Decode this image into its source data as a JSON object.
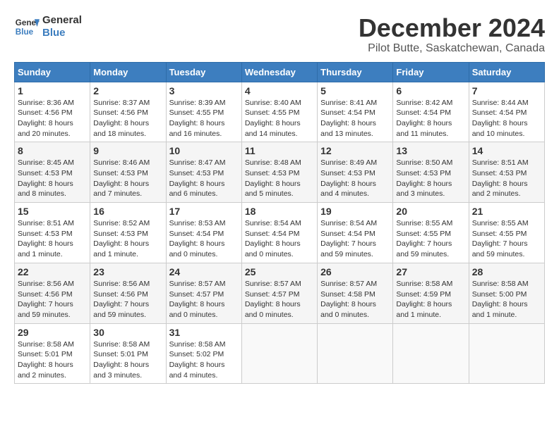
{
  "header": {
    "logo_line1": "General",
    "logo_line2": "Blue",
    "month": "December 2024",
    "location": "Pilot Butte, Saskatchewan, Canada"
  },
  "days_of_week": [
    "Sunday",
    "Monday",
    "Tuesday",
    "Wednesday",
    "Thursday",
    "Friday",
    "Saturday"
  ],
  "weeks": [
    [
      {
        "day": "1",
        "info": "Sunrise: 8:36 AM\nSunset: 4:56 PM\nDaylight: 8 hours and 20 minutes."
      },
      {
        "day": "2",
        "info": "Sunrise: 8:37 AM\nSunset: 4:56 PM\nDaylight: 8 hours and 18 minutes."
      },
      {
        "day": "3",
        "info": "Sunrise: 8:39 AM\nSunset: 4:55 PM\nDaylight: 8 hours and 16 minutes."
      },
      {
        "day": "4",
        "info": "Sunrise: 8:40 AM\nSunset: 4:55 PM\nDaylight: 8 hours and 14 minutes."
      },
      {
        "day": "5",
        "info": "Sunrise: 8:41 AM\nSunset: 4:54 PM\nDaylight: 8 hours and 13 minutes."
      },
      {
        "day": "6",
        "info": "Sunrise: 8:42 AM\nSunset: 4:54 PM\nDaylight: 8 hours and 11 minutes."
      },
      {
        "day": "7",
        "info": "Sunrise: 8:44 AM\nSunset: 4:54 PM\nDaylight: 8 hours and 10 minutes."
      }
    ],
    [
      {
        "day": "8",
        "info": "Sunrise: 8:45 AM\nSunset: 4:53 PM\nDaylight: 8 hours and 8 minutes."
      },
      {
        "day": "9",
        "info": "Sunrise: 8:46 AM\nSunset: 4:53 PM\nDaylight: 8 hours and 7 minutes."
      },
      {
        "day": "10",
        "info": "Sunrise: 8:47 AM\nSunset: 4:53 PM\nDaylight: 8 hours and 6 minutes."
      },
      {
        "day": "11",
        "info": "Sunrise: 8:48 AM\nSunset: 4:53 PM\nDaylight: 8 hours and 5 minutes."
      },
      {
        "day": "12",
        "info": "Sunrise: 8:49 AM\nSunset: 4:53 PM\nDaylight: 8 hours and 4 minutes."
      },
      {
        "day": "13",
        "info": "Sunrise: 8:50 AM\nSunset: 4:53 PM\nDaylight: 8 hours and 3 minutes."
      },
      {
        "day": "14",
        "info": "Sunrise: 8:51 AM\nSunset: 4:53 PM\nDaylight: 8 hours and 2 minutes."
      }
    ],
    [
      {
        "day": "15",
        "info": "Sunrise: 8:51 AM\nSunset: 4:53 PM\nDaylight: 8 hours and 1 minute."
      },
      {
        "day": "16",
        "info": "Sunrise: 8:52 AM\nSunset: 4:53 PM\nDaylight: 8 hours and 1 minute."
      },
      {
        "day": "17",
        "info": "Sunrise: 8:53 AM\nSunset: 4:54 PM\nDaylight: 8 hours and 0 minutes."
      },
      {
        "day": "18",
        "info": "Sunrise: 8:54 AM\nSunset: 4:54 PM\nDaylight: 8 hours and 0 minutes."
      },
      {
        "day": "19",
        "info": "Sunrise: 8:54 AM\nSunset: 4:54 PM\nDaylight: 7 hours and 59 minutes."
      },
      {
        "day": "20",
        "info": "Sunrise: 8:55 AM\nSunset: 4:55 PM\nDaylight: 7 hours and 59 minutes."
      },
      {
        "day": "21",
        "info": "Sunrise: 8:55 AM\nSunset: 4:55 PM\nDaylight: 7 hours and 59 minutes."
      }
    ],
    [
      {
        "day": "22",
        "info": "Sunrise: 8:56 AM\nSunset: 4:56 PM\nDaylight: 7 hours and 59 minutes."
      },
      {
        "day": "23",
        "info": "Sunrise: 8:56 AM\nSunset: 4:56 PM\nDaylight: 7 hours and 59 minutes."
      },
      {
        "day": "24",
        "info": "Sunrise: 8:57 AM\nSunset: 4:57 PM\nDaylight: 8 hours and 0 minutes."
      },
      {
        "day": "25",
        "info": "Sunrise: 8:57 AM\nSunset: 4:57 PM\nDaylight: 8 hours and 0 minutes."
      },
      {
        "day": "26",
        "info": "Sunrise: 8:57 AM\nSunset: 4:58 PM\nDaylight: 8 hours and 0 minutes."
      },
      {
        "day": "27",
        "info": "Sunrise: 8:58 AM\nSunset: 4:59 PM\nDaylight: 8 hours and 1 minute."
      },
      {
        "day": "28",
        "info": "Sunrise: 8:58 AM\nSunset: 5:00 PM\nDaylight: 8 hours and 1 minute."
      }
    ],
    [
      {
        "day": "29",
        "info": "Sunrise: 8:58 AM\nSunset: 5:01 PM\nDaylight: 8 hours and 2 minutes."
      },
      {
        "day": "30",
        "info": "Sunrise: 8:58 AM\nSunset: 5:01 PM\nDaylight: 8 hours and 3 minutes."
      },
      {
        "day": "31",
        "info": "Sunrise: 8:58 AM\nSunset: 5:02 PM\nDaylight: 8 hours and 4 minutes."
      },
      null,
      null,
      null,
      null
    ]
  ]
}
